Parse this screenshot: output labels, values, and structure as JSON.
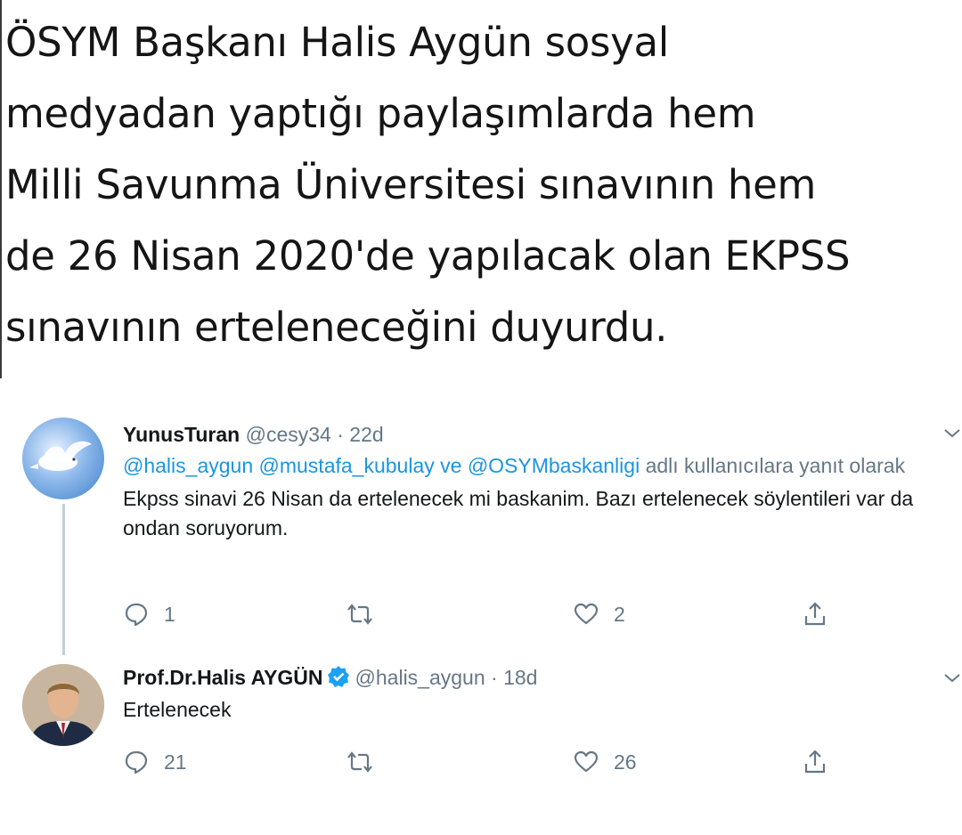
{
  "headline": "ÖSYM Başkanı Halis Aygün sosyal\nmedyadan yaptığı paylaşımlarda hem\nMilli Savunma Üniversitesi sınavının hem\nde 26 Nisan 2020'de yapılacak olan EKPSS\nsınavının erteleneceğini duyurdu.",
  "tweet1": {
    "name": "YunusTuran",
    "handle": "@cesy34",
    "separator": "·",
    "time": "22d",
    "reply_mentions": [
      "@halis_aygun",
      "@mustafa_kubulay",
      "@OSYMbaskanligi"
    ],
    "reply_word": "ve",
    "reply_suffix": "adlı kullanıcılara yanıt olarak",
    "text": "Ekpss sinavi 26 Nisan da ertelenecek mi baskanim. Bazı ertelenecek söylentileri var da ondan soruyorum.",
    "reply_count": "1",
    "retweet_count": "",
    "like_count": "2"
  },
  "tweet2": {
    "name": "Prof.Dr.Halis AYGÜN",
    "handle": "@halis_aygun",
    "separator": "·",
    "time": "18d",
    "text": "Ertelenecek",
    "reply_count": "21",
    "retweet_count": "",
    "like_count": "26"
  },
  "colors": {
    "link": "#1b95e0",
    "muted": "#657786",
    "text": "#14171a",
    "verified": "#1da1f2",
    "thread_line": "#c4cfd6"
  },
  "icons": {
    "avatar1": "dove-on-blue-sky-avatar",
    "avatar2": "man-in-suit-avatar",
    "reply": "speech-bubble-icon",
    "retweet": "retweet-arrows-icon",
    "like": "heart-icon",
    "share": "share-arrow-icon",
    "more": "chevron-down-icon",
    "verified": "verified-badge-icon"
  }
}
